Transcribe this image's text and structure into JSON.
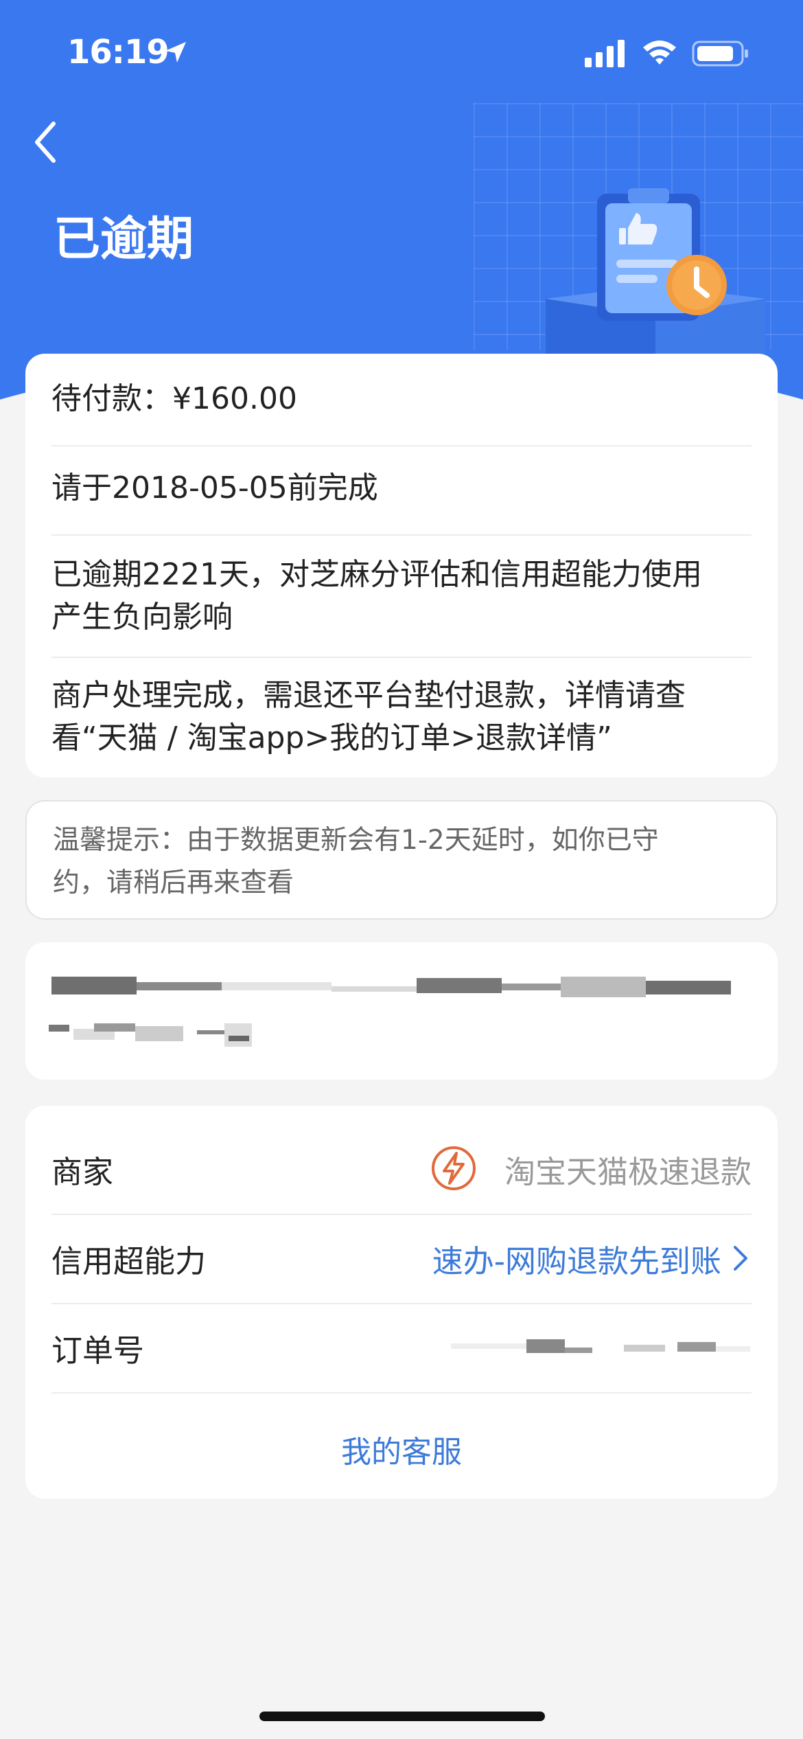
{
  "status_bar": {
    "time": "16:19"
  },
  "header": {
    "title": "已逾期"
  },
  "summary": {
    "amount": "待付款：¥160.00",
    "deadline": "请于2018-05-05前完成",
    "overdue_line1": "已逾期2221天，对芝麻分评估和信用超能力使用",
    "overdue_line2": "产生负向影响",
    "refund_line1": "商户处理完成，需退还平台垫付退款，详情请查",
    "refund_line2": "看“天猫 / 淘宝app>我的订单>退款详情”"
  },
  "tip": {
    "line1": "温馨提示：由于数据更新会有1-2天延时，如你已守",
    "line2": "约，请稍后再来查看"
  },
  "details": {
    "merchant_label": "商家",
    "merchant_value": "淘宝天猫极速退款",
    "credit_label": "信用超能力",
    "credit_value": "速办-网购退款先到账",
    "order_label": "订单号",
    "service_link": "我的客服"
  },
  "colors": {
    "header_blue": "#3a78f0",
    "link_blue": "#3d7bd9",
    "merchant_orange": "#e06a3b",
    "background": "#f4f4f4"
  },
  "icons": {
    "back": "chevron-left-icon",
    "location": "location-arrow-icon",
    "merchant": "lightning-bolt-icon",
    "credit_arrow": "chevron-right-icon"
  }
}
